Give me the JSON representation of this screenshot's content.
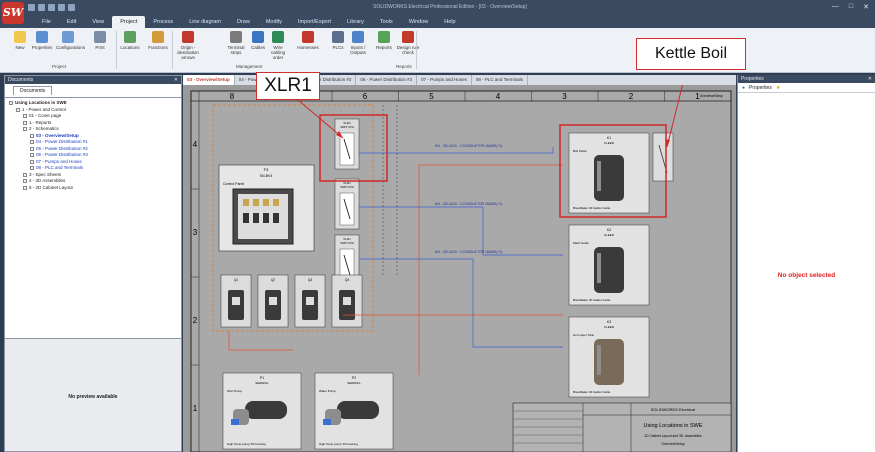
{
  "app": {
    "logo": "SW",
    "title": "SOLIDWORKS Electrical Professional Edition - [03 - Overview/Setup]"
  },
  "menu": [
    "File",
    "Edit",
    "View",
    "Project",
    "Process",
    "Line diagram",
    "Draw",
    "Modify",
    "Import/Export",
    "Library",
    "Tools",
    "Window",
    "Help"
  ],
  "menu_active": "Project",
  "ribbon": {
    "buttons": [
      {
        "label": "New",
        "color": "#f1c84b"
      },
      {
        "label": "Properties",
        "color": "#5b8fd1"
      },
      {
        "label": "Configurations",
        "color": "#6e9bd3"
      },
      {
        "label": "Print",
        "color": "#7a8ca8"
      },
      {
        "label": "Locations",
        "color": "#5fa05f"
      },
      {
        "label": "Functions",
        "color": "#d49a3a"
      },
      {
        "label": "Origin - destination arrows",
        "color": "#c0392b"
      },
      {
        "label": "Terminal strips",
        "color": "#7a7a7a"
      },
      {
        "label": "Cables",
        "color": "#3b74c2"
      },
      {
        "label": "Wire cabling order",
        "color": "#2e8b57"
      },
      {
        "label": "Harnesses",
        "color": "#c0392b"
      },
      {
        "label": "PLCs",
        "color": "#5b6e8c"
      },
      {
        "label": "Inputs / Outputs",
        "color": "#4f83c9"
      },
      {
        "label": "Reports",
        "color": "#56a356"
      },
      {
        "label": "Design rule check",
        "color": "#c0392b"
      }
    ],
    "groups": [
      "Project",
      "Management",
      "Reports"
    ]
  },
  "documents_panel": {
    "title": "Documents",
    "tab": "Documents",
    "tree": [
      {
        "label": "Using Locations in SWE",
        "indent": 0,
        "style": "bold"
      },
      {
        "label": "1 - Power and Control",
        "indent": 1,
        "style": ""
      },
      {
        "label": "01 - Cover page",
        "indent": 2,
        "style": ""
      },
      {
        "label": "1 - Reports",
        "indent": 2,
        "style": ""
      },
      {
        "label": "2 - Schematics",
        "indent": 2,
        "style": ""
      },
      {
        "label": "03 - Overview/Setup",
        "indent": 3,
        "style": "sel"
      },
      {
        "label": "04 - Power Distribution #1",
        "indent": 3,
        "style": "blue"
      },
      {
        "label": "05 - Power Distribution #2",
        "indent": 3,
        "style": "blue"
      },
      {
        "label": "06 - Power Distribution #3",
        "indent": 3,
        "style": "blue"
      },
      {
        "label": "07 - Pumps and Hoses",
        "indent": 3,
        "style": "blue"
      },
      {
        "label": "08 - PLC and Terminals",
        "indent": 3,
        "style": "blue"
      },
      {
        "label": "3 - Spec Sheets",
        "indent": 2,
        "style": ""
      },
      {
        "label": "4 - 3D Assemblies",
        "indent": 2,
        "style": ""
      },
      {
        "label": "5 - 2D Cabinet Layout",
        "indent": 2,
        "style": ""
      }
    ],
    "preview_text": "No preview available"
  },
  "properties_panel": {
    "title": "Properties",
    "tab": "Properties",
    "empty_text": "No object selected"
  },
  "doc_tabs": [
    "03 - Overview/Setup",
    "04 - Power Distribution #1",
    "05 - Power Distribution #2",
    "06 - Power Distribution #3",
    "07 - Pumps and Hoses",
    "08 - PLC and Terminals"
  ],
  "drawing": {
    "columns": [
      "8",
      "7",
      "6",
      "5",
      "4",
      "3",
      "2",
      "1"
    ],
    "rows": [
      "4",
      "3",
      "2",
      "1"
    ],
    "callout_xlr1": "XLR1",
    "callout_kettle": "Kettle Boil",
    "panel_tag": "F3",
    "panel_sub": "SN-BV4",
    "panel_name": "Control Panel",
    "xlr_tag": "XLR1",
    "xlr_sub": "SWFT-CPH",
    "wire_labels": [
      "W4 - 2/6-14GX - 3 CONDUCTOR 16AWG(+1)",
      "W4 - 2/6-14GX - 3 CONDUCTOR 16AWG(+1)",
      "W4 - 2/6-14GX - 3 CONDUCTOR 16AWG(+1)"
    ],
    "kettles": [
      {
        "tag": "K1",
        "sub": "KLEER",
        "name": "Boil Kettle",
        "foot": "BrewMaker 30 Gallon Kettle"
      },
      {
        "tag": "K2",
        "sub": "KLEER",
        "name": "Mash Kettle",
        "foot": "BrewMaker 30 Gallon Kettle"
      },
      {
        "tag": "K3",
        "sub": "KLEER",
        "name": "Hot Liquor Tank",
        "foot": "BrewMaker 30 Gallon Kettle"
      }
    ],
    "breakers": [
      "Q1",
      "Q2",
      "Q3",
      "Q4"
    ],
    "pumps": [
      {
        "tag": "P1",
        "sub": "SERIES/L",
        "name": "Wort Pump",
        "foot": "High Temp pump SS housing"
      },
      {
        "tag": "P2",
        "sub": "SERIES/L",
        "name": "Water Pump",
        "foot": "High Temp pump SS housing"
      }
    ],
    "titleblock": {
      "company": "SOLIDWORKS Electrical",
      "title": "Using Locations in SWE",
      "sub": "2D Cabinet Layout and 3D: Assemblies",
      "sheet": "Overview/Setup"
    }
  }
}
